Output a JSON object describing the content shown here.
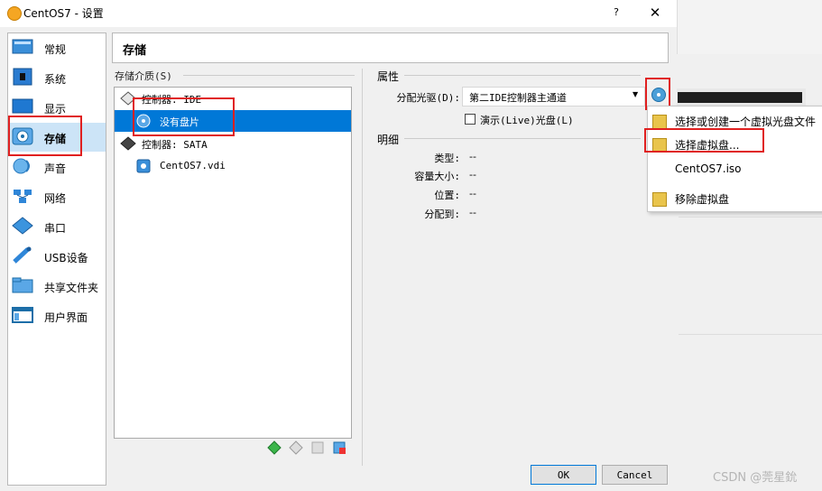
{
  "window": {
    "title": "CentOS7 - 设置",
    "help": "?",
    "close": "✕"
  },
  "sidebar": {
    "items": [
      {
        "label": "常规",
        "icon": "general-icon"
      },
      {
        "label": "系统",
        "icon": "system-icon"
      },
      {
        "label": "显示",
        "icon": "display-icon"
      },
      {
        "label": "存储",
        "icon": "storage-icon"
      },
      {
        "label": "声音",
        "icon": "audio-icon"
      },
      {
        "label": "网络",
        "icon": "network-icon"
      },
      {
        "label": "串口",
        "icon": "serial-port-icon"
      },
      {
        "label": "USB设备",
        "icon": "usb-icon"
      },
      {
        "label": "共享文件夹",
        "icon": "shared-folder-icon"
      },
      {
        "label": "用户界面",
        "icon": "user-interface-icon"
      }
    ],
    "selected": "存储"
  },
  "page": {
    "title": "存储"
  },
  "storage_media": {
    "label": "存储介质(S)",
    "tree": [
      {
        "label": "控制器: IDE",
        "kind": "controller"
      },
      {
        "label": "没有盘片",
        "kind": "optical",
        "selected": true
      },
      {
        "label": "控制器: SATA",
        "kind": "controller"
      },
      {
        "label": "CentOS7.vdi",
        "kind": "disk"
      }
    ]
  },
  "attributes": {
    "title": "属性",
    "drive_label": "分配光驱(D):",
    "drive_value": "第二IDE控制器主通道",
    "live_label": "演示(Live)光盘(L)",
    "live_checked": false
  },
  "details": {
    "title": "明细",
    "rows": [
      {
        "label": "类型:",
        "value": "--"
      },
      {
        "label": "容量大小:",
        "value": "--"
      },
      {
        "label": "位置:",
        "value": "--"
      },
      {
        "label": "分配到:",
        "value": "--"
      }
    ]
  },
  "menu": {
    "items": [
      {
        "label": "选择或创建一个虚拟光盘文件"
      },
      {
        "label": "选择虚拟盘..."
      },
      {
        "label": "CentOS7.iso"
      },
      {
        "label": "移除虚拟盘"
      }
    ]
  },
  "buttons": {
    "ok": "OK",
    "cancel": "Cancel"
  },
  "watermark": "CSDN @莞星鈗",
  "colors": {
    "selection": "#0078d7",
    "highlight": "#e02020",
    "sidebar_selected": "#cce4f7"
  }
}
